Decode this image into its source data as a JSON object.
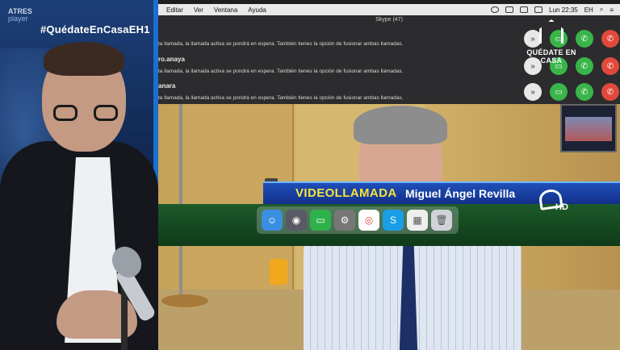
{
  "overlay": {
    "brand_line1": "ATRES",
    "brand_line2": "player",
    "hashtag": "#QuédateEnCasaEH1",
    "logo_text": "QUÉDATE EN CASA"
  },
  "menubar": {
    "items": [
      "Editar",
      "Ver",
      "Ventana",
      "Ayuda"
    ],
    "clock": "Lun 22:35",
    "user": "EH"
  },
  "skype": {
    "window_title": "Skype (47)",
    "entries": [
      {
        "name": "",
        "message": "ta llamada, la llamada activa se pondrá en espera. También tienes la opción de fusionar ambas llamadas."
      },
      {
        "name": "ro.anaya",
        "message": "ta llamada, la llamada activa se pondrá en espera. También tienes la opción de fusionar ambas llamadas."
      },
      {
        "name": "anara",
        "message": "ta llamada, la llamada activa se pondrá en espera. También tienes la opción de fusionar ambas llamadas."
      }
    ]
  },
  "lower_third": {
    "tag": "VIDEOLLAMADA",
    "name": "Miguel Ángel Revilla",
    "channel_badge": "HD"
  },
  "dock": {
    "apps": [
      "finder-icon",
      "launchpad-icon",
      "facetime-icon",
      "settings-icon",
      "chrome-icon",
      "skype-icon",
      "preview-icon",
      "trash-icon"
    ]
  },
  "colors": {
    "accept": "#3ab54a",
    "decline": "#e14a3b",
    "lower_third_blue": "#1e4fb8",
    "tag_yellow": "#f7e33a"
  }
}
